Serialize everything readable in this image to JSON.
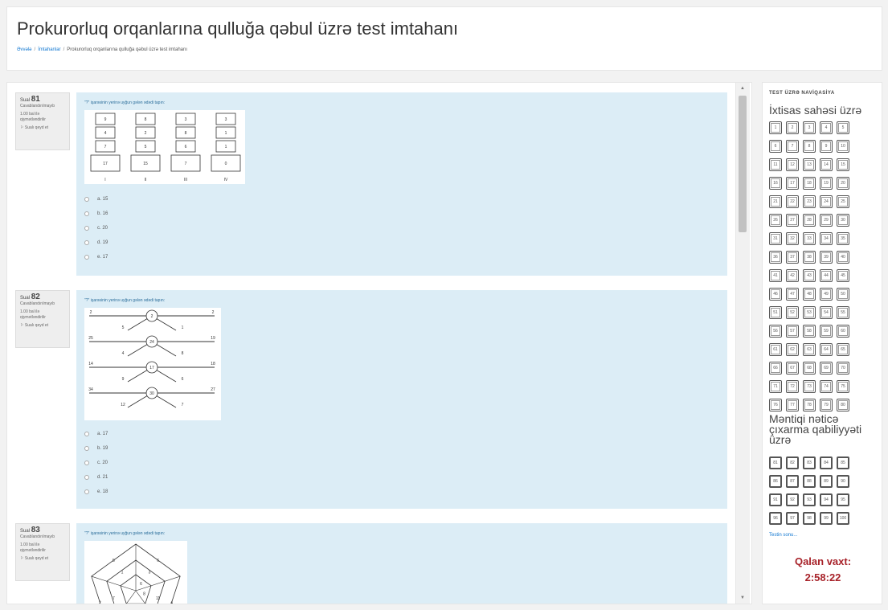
{
  "page": {
    "title": "Prokurorluq orqanlarına qulluğa qəbul üzrə test imtahanı"
  },
  "breadcrumb": [
    "Əvvələ",
    "İmtahanlar",
    "Prokurorluq orqanlarına qulluğa qəbul üzrə test imtahanı"
  ],
  "questions": [
    {
      "label": "Sual",
      "number": "81",
      "status": "Cavablandırılmayıb",
      "score": "1.00 bal ilə qiymətləndirilir",
      "flag": "Sualı qeyd et",
      "text": "\"?\" işarəsinin yerinə uyğun gələn ədədi tapın:",
      "figure": {
        "type": "columns",
        "cols": [
          {
            "cells": [
              "9",
              "4",
              "7"
            ],
            "sum": "17",
            "label": "I"
          },
          {
            "cells": [
              "8",
              "2",
              "5"
            ],
            "sum": "15",
            "label": "II"
          },
          {
            "cells": [
              "3",
              "8",
              "6"
            ],
            "sum": "7",
            "label": "III"
          },
          {
            "cells": [
              "3",
              "1",
              "1"
            ],
            "sum": "0",
            "label": "IV"
          }
        ]
      },
      "options": [
        "a. 15",
        "b. 16",
        "c. 20",
        "d. 19",
        "e. 17"
      ]
    },
    {
      "label": "Sual",
      "number": "82",
      "status": "Cavablandırılmayıb",
      "score": "1.00 bal ilə qiymətləndirilir",
      "flag": "Sualı qeyd et",
      "text": "\"?\" işarəsinin yerinə uyğun gələn ədədi tapın:",
      "figure": {
        "type": "arrows",
        "rows": [
          {
            "left": "2",
            "center": "2",
            "right": "2",
            "bl": "5",
            "br": "1"
          },
          {
            "left": "25",
            "center": "24",
            "right": "19",
            "bl": "4",
            "br": "8"
          },
          {
            "left": "14",
            "center": "17",
            "right": "18",
            "bl": "9",
            "br": "6"
          },
          {
            "left": "34",
            "center": "30",
            "right": "27",
            "bl": "12",
            "br": "7"
          }
        ]
      },
      "options": [
        "a. 17",
        "b. 19",
        "c. 20",
        "d. 21",
        "e. 18"
      ]
    },
    {
      "label": "Sual",
      "number": "83",
      "status": "Cavablandırılmayıb",
      "score": "1.00 bal ilə qiymətləndirilir",
      "flag": "Sualı qeyd et",
      "text": "\"?\" işarəsinin yerinə uyğun gələn ədədi tapın:",
      "figure": {
        "type": "pentagon",
        "numbers": [
          "6",
          "4",
          "3",
          "2",
          "5",
          "3",
          "11",
          "9",
          "7",
          "1",
          "6",
          "8"
        ]
      },
      "options": []
    }
  ],
  "nav": {
    "title": "TEST ÜZRƏ NAVİQASİYA",
    "section1": "İxtisas sahəsi üzrə",
    "section2": "Məntiqi nəticə çıxarma qabiliyyəti üzrə",
    "finish": "Testin sonu...",
    "timer_label": "Qalan vaxt:",
    "timer_value": "2:58:22"
  },
  "colors": {
    "accent": "#1177d1",
    "timer": "#a8232a",
    "question_bg": "#dcedf6"
  }
}
